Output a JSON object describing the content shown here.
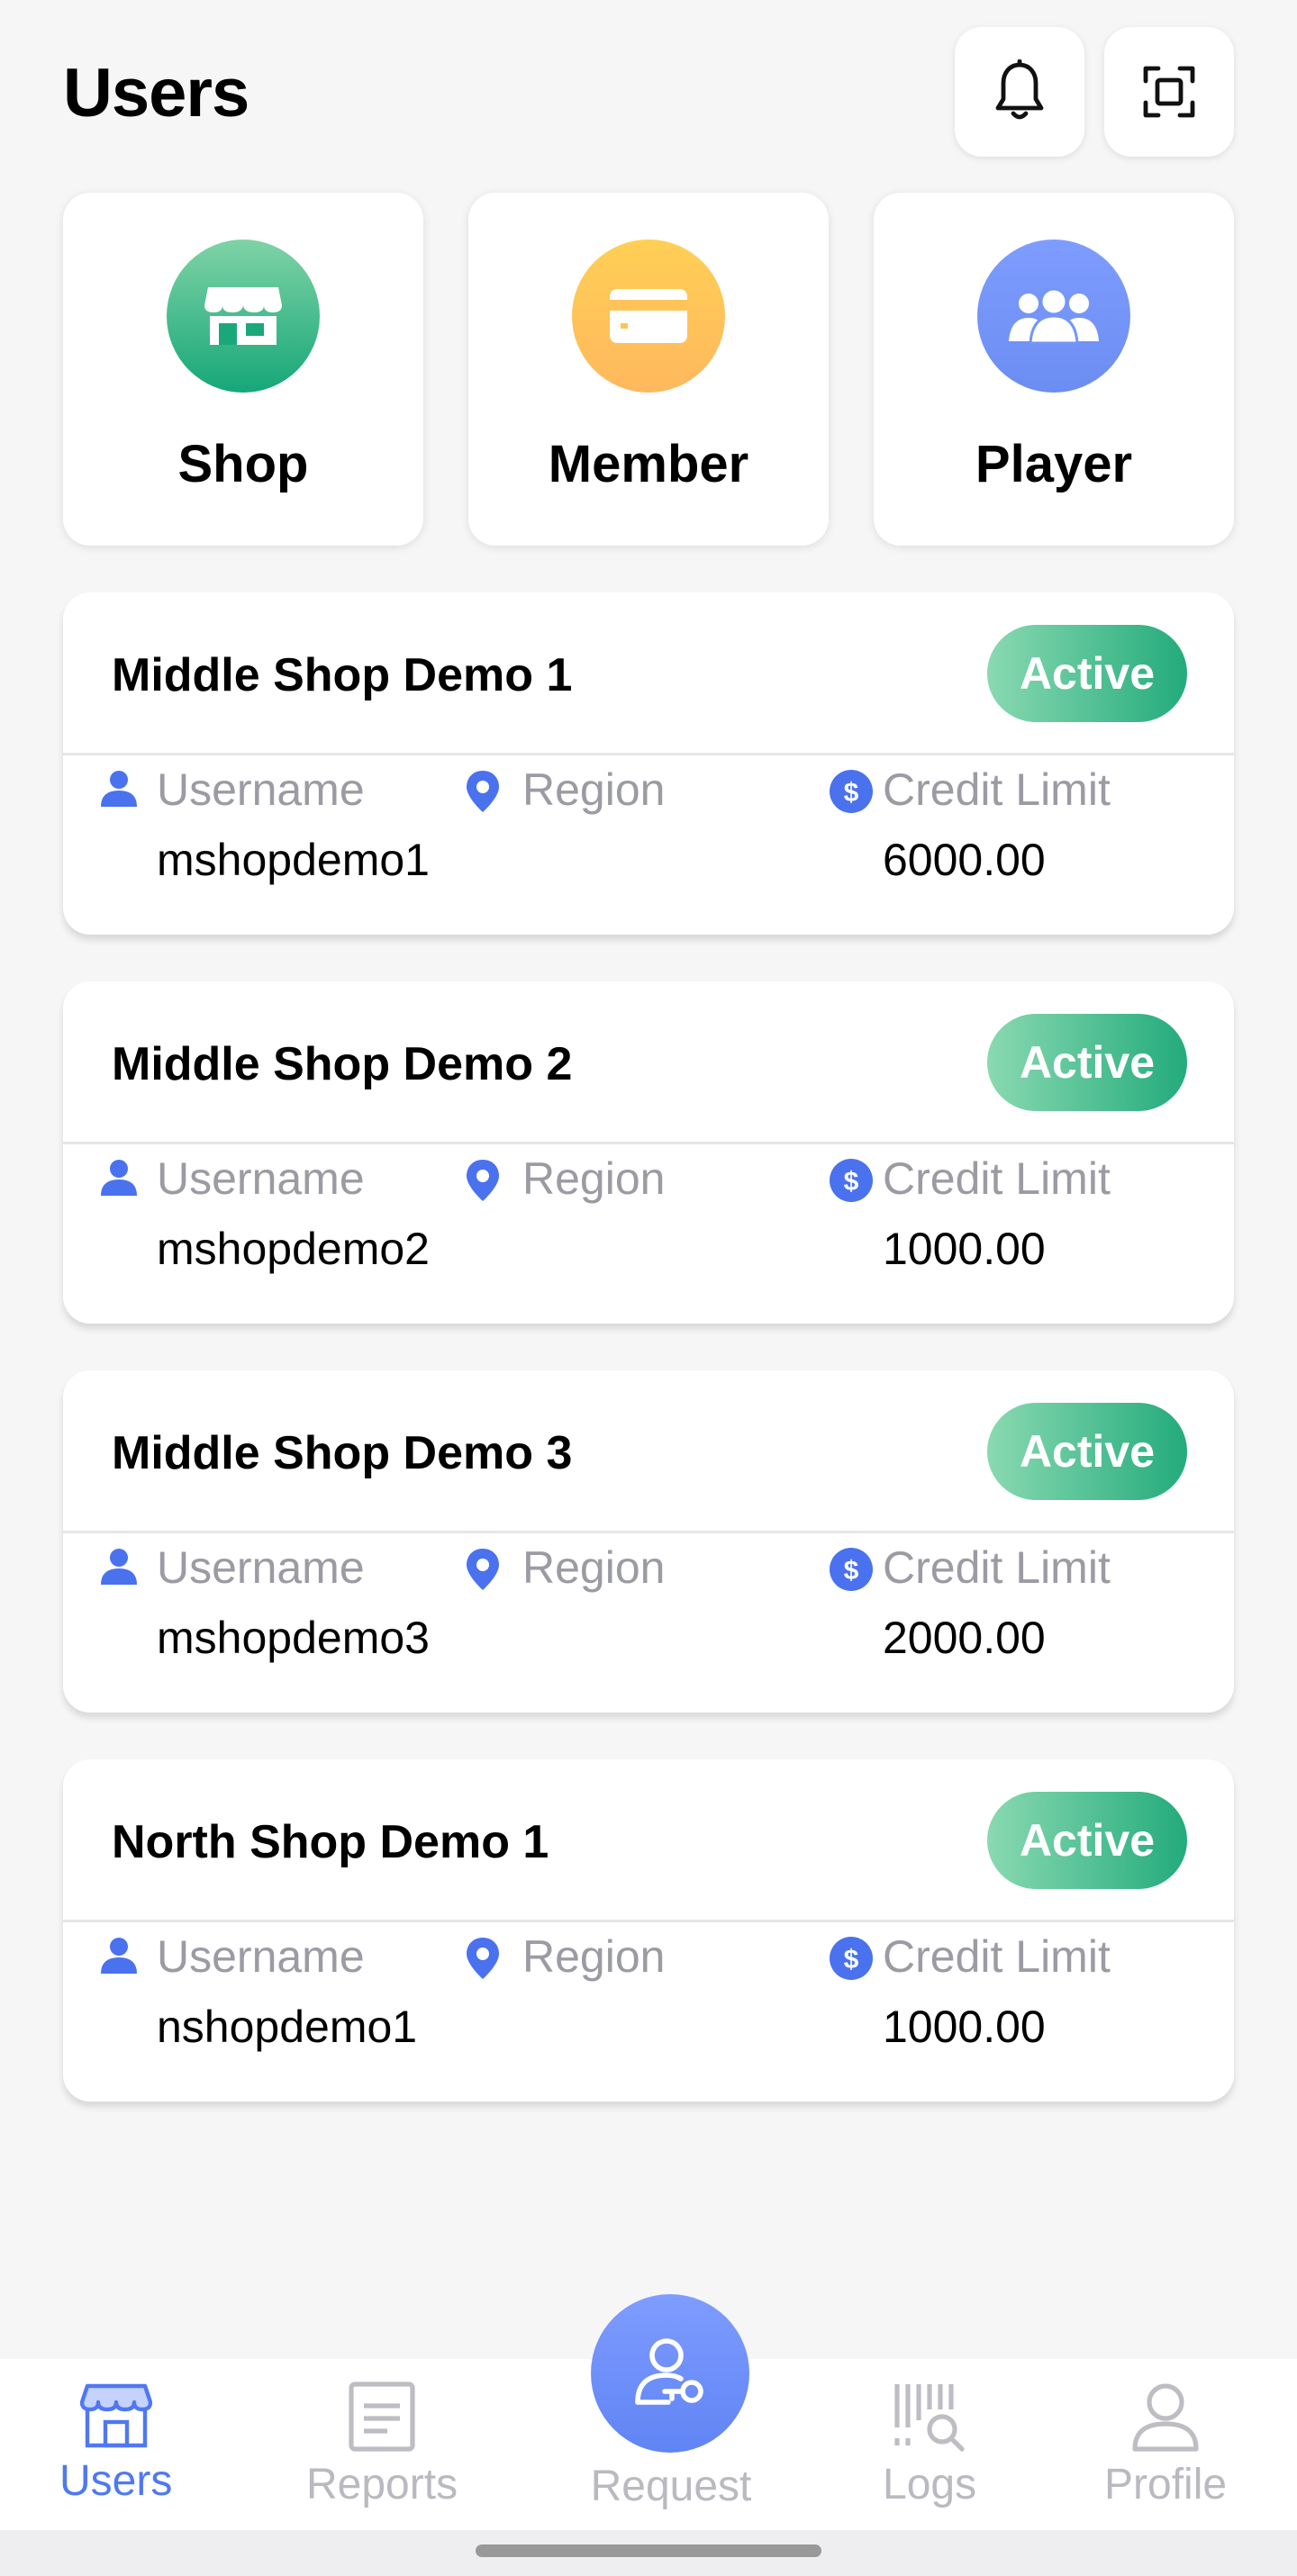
{
  "header": {
    "title": "Users",
    "notification_icon": "bell-icon",
    "scan_icon": "scan-icon"
  },
  "categories": [
    {
      "label": "Shop",
      "icon": "shop-icon",
      "color": "#16a779"
    },
    {
      "label": "Member",
      "icon": "card-icon",
      "color": "#ffb85e"
    },
    {
      "label": "Player",
      "icon": "group-icon",
      "color": "#6b8df2"
    }
  ],
  "field_labels": {
    "username": "Username",
    "region": "Region",
    "credit_limit": "Credit Limit"
  },
  "shops": [
    {
      "name": "Middle Shop Demo 1",
      "status": "Active",
      "username": "mshopdemo1",
      "region": "",
      "credit_limit": "6000.00"
    },
    {
      "name": "Middle Shop Demo 2",
      "status": "Active",
      "username": "mshopdemo2",
      "region": "",
      "credit_limit": "1000.00"
    },
    {
      "name": "Middle Shop Demo 3",
      "status": "Active",
      "username": "mshopdemo3",
      "region": "",
      "credit_limit": "2000.00"
    },
    {
      "name": "North Shop Demo 1",
      "status": "Active",
      "username": "nshopdemo1",
      "region": "",
      "credit_limit": "1000.00"
    }
  ],
  "bottom_nav": {
    "items": [
      {
        "label": "Users",
        "icon": "store-icon",
        "active": true
      },
      {
        "label": "Reports",
        "icon": "document-icon",
        "active": false
      },
      {
        "label": "Request",
        "icon": "user-key-icon",
        "active": false
      },
      {
        "label": "Logs",
        "icon": "barcode-search-icon",
        "active": false
      },
      {
        "label": "Profile",
        "icon": "person-icon",
        "active": false
      }
    ]
  },
  "colors": {
    "accent": "#4f78f3",
    "active_badge": "#23ab7c",
    "background": "#f6f6f7"
  }
}
